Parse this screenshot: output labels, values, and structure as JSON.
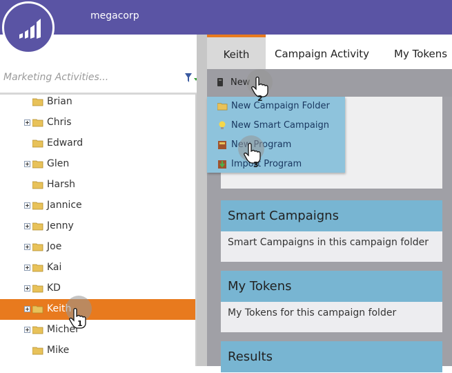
{
  "header": {
    "company": "megacorp"
  },
  "search": {
    "placeholder": "Marketing Activities..."
  },
  "tree": [
    {
      "label": "Brian",
      "expandable": false
    },
    {
      "label": "Chris",
      "expandable": true
    },
    {
      "label": "Edward",
      "expandable": false
    },
    {
      "label": "Glen",
      "expandable": true
    },
    {
      "label": "Harsh",
      "expandable": false
    },
    {
      "label": "Jannice",
      "expandable": true
    },
    {
      "label": "Jenny",
      "expandable": true
    },
    {
      "label": "Joe",
      "expandable": true
    },
    {
      "label": "Kai",
      "expandable": true
    },
    {
      "label": "KD",
      "expandable": true
    },
    {
      "label": "Keith",
      "expandable": true,
      "selected": true
    },
    {
      "label": "Michel",
      "expandable": true
    },
    {
      "label": "Mike",
      "expandable": false
    }
  ],
  "tabs": [
    "Keith",
    "Campaign Activity",
    "My Tokens"
  ],
  "toolbar": {
    "new_label": "New"
  },
  "menu": [
    {
      "label": "New Campaign Folder",
      "icon": "folder-icon"
    },
    {
      "label": "New Smart Campaign",
      "icon": "lightbulb-icon"
    },
    {
      "label": "New Program",
      "icon": "program-icon"
    },
    {
      "label": "Import Program",
      "icon": "import-program-icon"
    }
  ],
  "sections": [
    {
      "title": "Smart Campaigns",
      "body": "Smart Campaigns in this campaign folder"
    },
    {
      "title": "My Tokens",
      "body": "My Tokens for this campaign folder"
    },
    {
      "title": "Results",
      "body": ""
    }
  ],
  "steps": [
    "1",
    "2",
    "3"
  ],
  "colors": {
    "header": "#5a54a4",
    "accent": "#e87a1e",
    "section": "#78b5d2",
    "menu": "#8ec3dc"
  }
}
